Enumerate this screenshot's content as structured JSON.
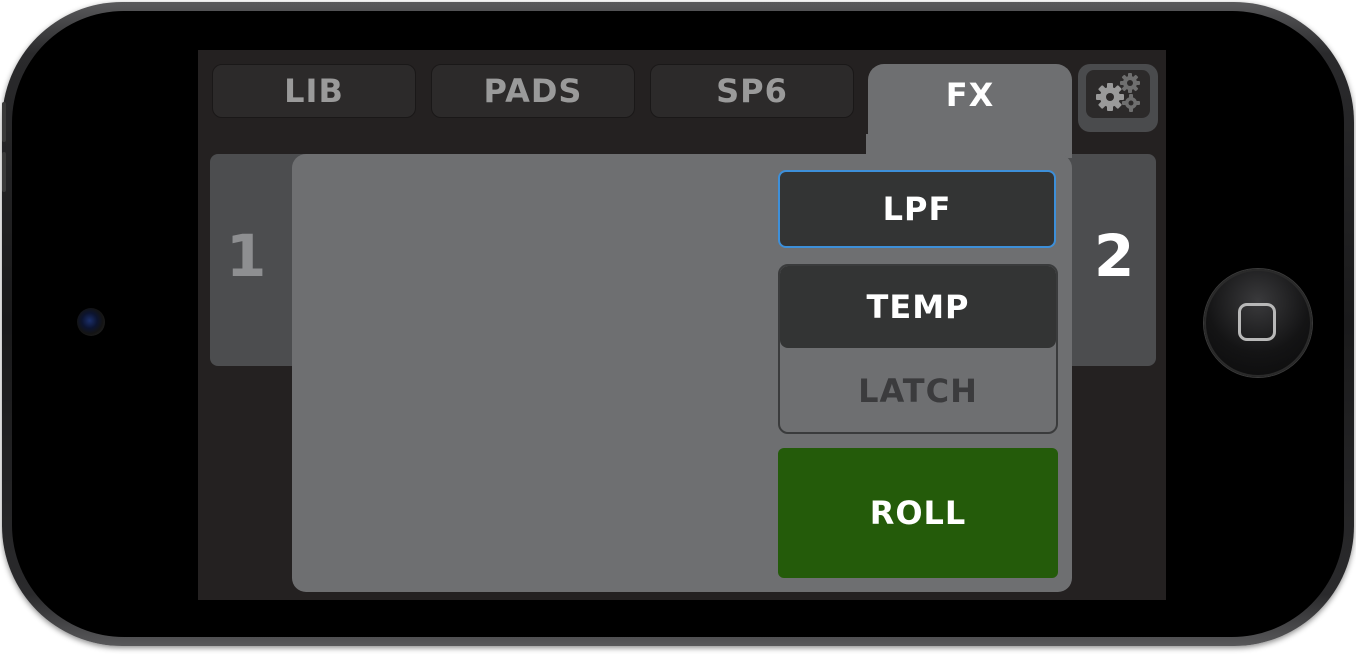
{
  "tabs": [
    {
      "label": "LIB",
      "active": false
    },
    {
      "label": "PADS",
      "active": false
    },
    {
      "label": "SP6",
      "active": false
    },
    {
      "label": "FX",
      "active": true
    }
  ],
  "settings": {
    "icon": "gears-icon"
  },
  "decks": {
    "left": "1",
    "right": "2"
  },
  "fx": {
    "effect_label": "LPF",
    "mode_options": [
      "TEMP",
      "LATCH"
    ],
    "mode_selected": "TEMP",
    "roll_label": "ROLL"
  },
  "colors": {
    "accent_border": "#3d8fd9",
    "roll_green": "#245b0a",
    "active_tab": "#6e6f71"
  }
}
